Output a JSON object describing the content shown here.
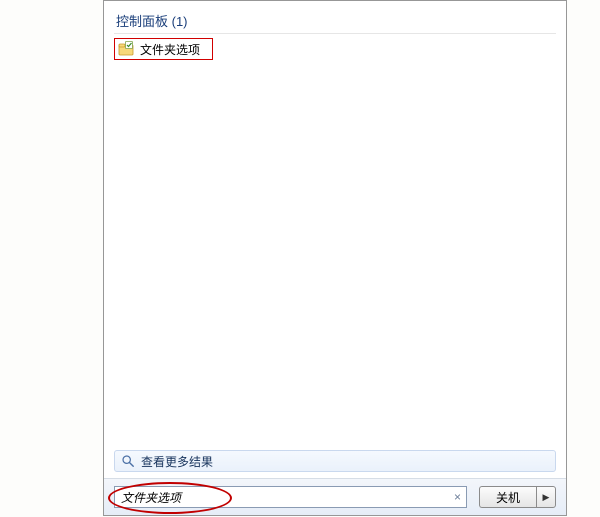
{
  "group": {
    "label": "控制面板 (1)"
  },
  "results": [
    {
      "label": "文件夹选项"
    }
  ],
  "more_results": {
    "label": "查看更多结果"
  },
  "search": {
    "value": "文件夹选项"
  },
  "shutdown": {
    "label": "关机"
  }
}
